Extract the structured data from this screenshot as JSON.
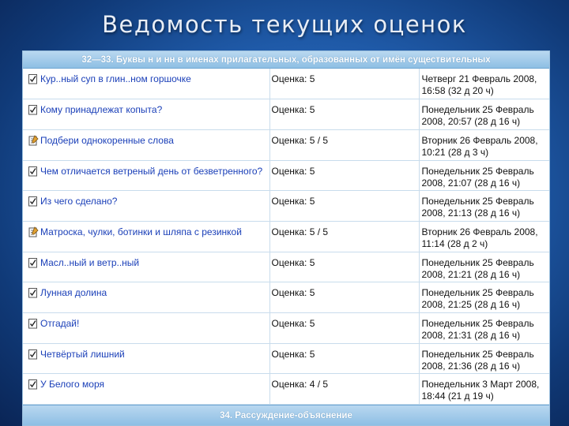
{
  "slide": {
    "title": "Ведомость текущих оценок"
  },
  "sheet": {
    "section_header": "32—33. Буквы н и нн в именах прилагательных, образованных от имён существительных",
    "footer_section": "34. Рассуждение-объяснение",
    "rows": [
      {
        "icon": "checklist-icon",
        "name": "Кур..ный суп в глин..ном горшочке",
        "grade": "Оценка: 5",
        "date": "Четверг 21 Февраль 2008, 16:58 (32 д 20 ч)"
      },
      {
        "icon": "checklist-icon",
        "name": "Кому принадлежат копыта?",
        "grade": "Оценка: 5",
        "date": "Понедельник 25 Февраль 2008, 20:57 (28 д 16 ч)"
      },
      {
        "icon": "assignment-icon",
        "name": "Подбери однокоренные слова",
        "grade": "Оценка: 5 / 5",
        "date": "Вторник 26 Февраль 2008, 10:21 (28 д 3 ч)"
      },
      {
        "icon": "checklist-icon",
        "name": "Чем отличается ветреный день от безветренного?",
        "grade": "Оценка: 5",
        "date": "Понедельник 25 Февраль 2008, 21:07 (28 д 16 ч)"
      },
      {
        "icon": "checklist-icon",
        "name": "Из чего сделано?",
        "grade": "Оценка: 5",
        "date": "Понедельник 25 Февраль 2008, 21:13 (28 д 16 ч)"
      },
      {
        "icon": "assignment-icon",
        "name": "Матроска, чулки, ботинки и шляпа с резинкой",
        "grade": "Оценка: 5 / 5",
        "date": "Вторник 26 Февраль 2008, 11:14 (28 д 2 ч)"
      },
      {
        "icon": "checklist-icon",
        "name": "Масл..ный и ветр..ный",
        "grade": "Оценка: 5",
        "date": "Понедельник 25 Февраль 2008, 21:21 (28 д 16 ч)"
      },
      {
        "icon": "checklist-icon",
        "name": "Лунная долина",
        "grade": "Оценка: 5",
        "date": "Понедельник 25 Февраль 2008, 21:25 (28 д 16 ч)"
      },
      {
        "icon": "checklist-icon",
        "name": "Отгадай!",
        "grade": "Оценка: 5",
        "date": "Понедельник 25 Февраль 2008, 21:31 (28 д 16 ч)"
      },
      {
        "icon": "checklist-icon",
        "name": "Четвёртый лишний",
        "grade": "Оценка: 5",
        "date": "Понедельник 25 Февраль 2008, 21:36 (28 д 16 ч)"
      },
      {
        "icon": "checklist-icon",
        "name": "У Белого моря",
        "grade": "Оценка: 4 / 5",
        "date": "Понедельник 3 Март 2008, 18:44 (21 д 19 ч)"
      }
    ]
  }
}
